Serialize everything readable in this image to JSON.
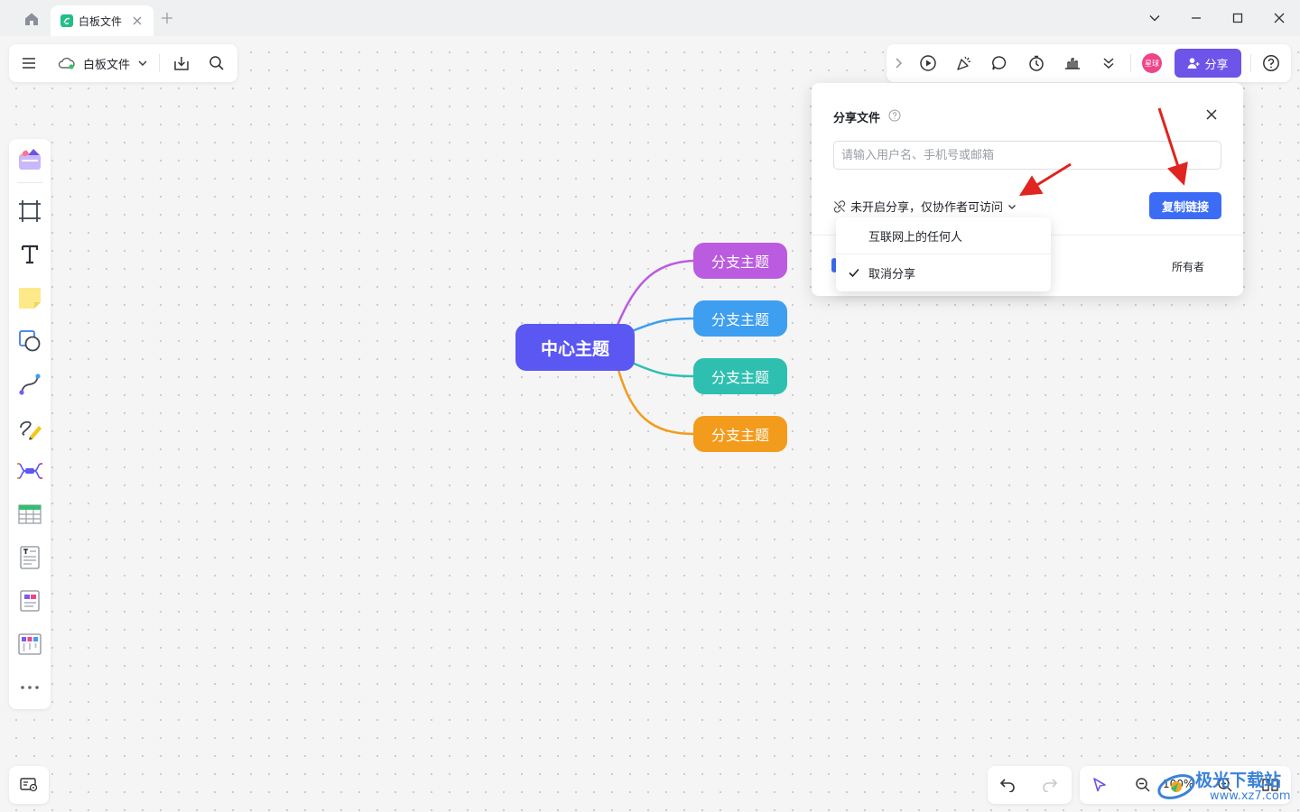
{
  "titlebar": {
    "tab_title": "白板文件"
  },
  "file_bar": {
    "title": "白板文件"
  },
  "right_bar": {
    "avatar_text": "星球",
    "share_label": "分享"
  },
  "mindmap": {
    "center": "中心主题",
    "branches": [
      {
        "label": "分支主题",
        "color": "#bb5be0"
      },
      {
        "label": "分支主题",
        "color": "#3e9ef0"
      },
      {
        "label": "分支主题",
        "color": "#2fbfb0"
      },
      {
        "label": "分支主题",
        "color": "#f39b1c"
      }
    ],
    "center_color": "#5b57f2"
  },
  "share_panel": {
    "title": "分享文件",
    "input_placeholder": "请输入用户名、手机号或邮箱",
    "status": "未开启分享，仅协作者可访问",
    "copy_link": "复制链接",
    "role": "所有者"
  },
  "dropdown": {
    "items": [
      {
        "label": "互联网上的任何人",
        "checked": false
      },
      {
        "label": "取消分享",
        "checked": true
      }
    ]
  },
  "zoom": {
    "value": "100%"
  },
  "watermark": {
    "line1": "极光下载站",
    "line2": "www.xz7.com"
  },
  "colors": {
    "accent": "#6e54e8",
    "primary_button": "#3c6cf5",
    "annotation_arrow": "#e0241f"
  }
}
